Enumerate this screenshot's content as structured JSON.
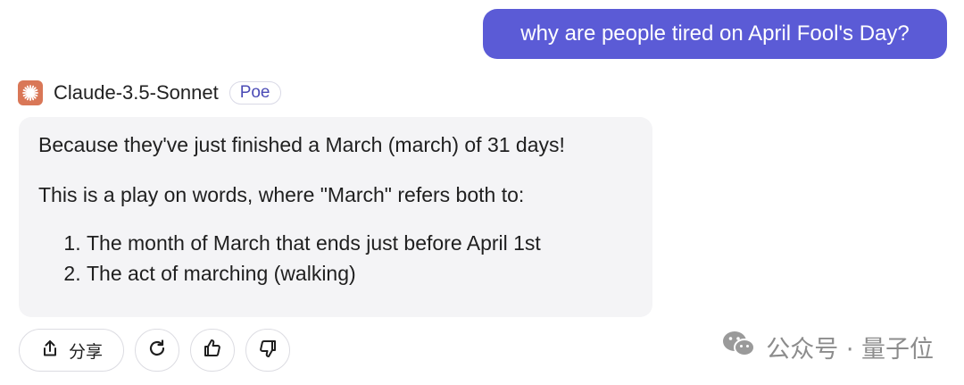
{
  "user_message": {
    "text": "why are people tired on April Fool's Day?"
  },
  "bot": {
    "avatar_icon": "claude-sparkle-icon",
    "avatar_color": "#d97757",
    "name": "Claude-3.5-Sonnet",
    "badge": "Poe"
  },
  "response": {
    "paragraph_1": "Because they've just finished a March (march) of 31 days!",
    "paragraph_2": "This is a play on words, where \"March\" refers both to:",
    "list": [
      "The month of March that ends just before April 1st",
      "The act of marching (walking)"
    ]
  },
  "actions": {
    "share_icon": "share-icon",
    "share_label": "分享",
    "retry_icon": "retry-icon",
    "like_icon": "thumbs-up-icon",
    "dislike_icon": "thumbs-down-icon"
  },
  "watermark": {
    "icon": "wechat-icon",
    "text": "公众号 · 量子位"
  },
  "colors": {
    "user_bubble": "#5b5bd6",
    "bot_bubble": "#f4f4f6",
    "badge_text": "#4b4bb6"
  }
}
